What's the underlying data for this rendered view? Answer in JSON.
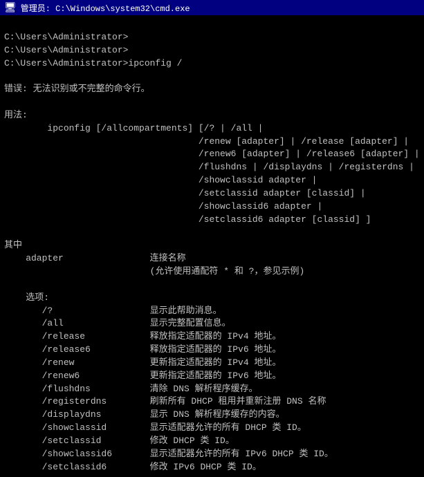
{
  "titleBar": {
    "icon": "🖥",
    "title": "管理员: C:\\Windows\\system32\\cmd.exe"
  },
  "terminal": {
    "lines": [
      "C:\\Users\\Administrator>",
      "C:\\Users\\Administrator>",
      "C:\\Users\\Administrator>ipconfig /",
      "",
      "错误: 无法识别或不完整的命令行。",
      "",
      "用法:",
      "        ipconfig [/allcompartments] [/? | /all |",
      "                                    /renew [adapter] | /release [adapter] |",
      "                                    /renew6 [adapter] | /release6 [adapter] |",
      "                                    /flushdns | /displaydns | /registerdns |",
      "                                    /showclassid adapter |",
      "                                    /setclassid adapter [classid] |",
      "                                    /showclassid6 adapter |",
      "                                    /setclassid6 adapter [classid] ]",
      "",
      "其中",
      "    adapter                连接名称",
      "                           (允许使用通配符 * 和 ?，参见示例)",
      "",
      "    选项:",
      "       /?                  显示此帮助消息。",
      "       /all                显示完整配置信息。",
      "       /release            释放指定适配器的 IPv4 地址。",
      "       /release6           释放指定适配器的 IPv6 地址。",
      "       /renew              更新指定适配器的 IPv4 地址。",
      "       /renew6             更新指定适配器的 IPv6 地址。",
      "       /flushdns           清除 DNS 解析程序缓存。",
      "       /registerdns        刷新所有 DHCP 租用并重新注册 DNS 名称",
      "       /displaydns         显示 DNS 解析程序缓存的内容。",
      "       /showclassid        显示适配器允许的所有 DHCP 类 ID。",
      "       /setclassid         修改 DHCP 类 ID。",
      "       /showclassid6       显示适配器允许的所有 IPv6 DHCP 类 ID。",
      "       /setclassid6        修改 IPv6 DHCP 类 ID。"
    ]
  }
}
